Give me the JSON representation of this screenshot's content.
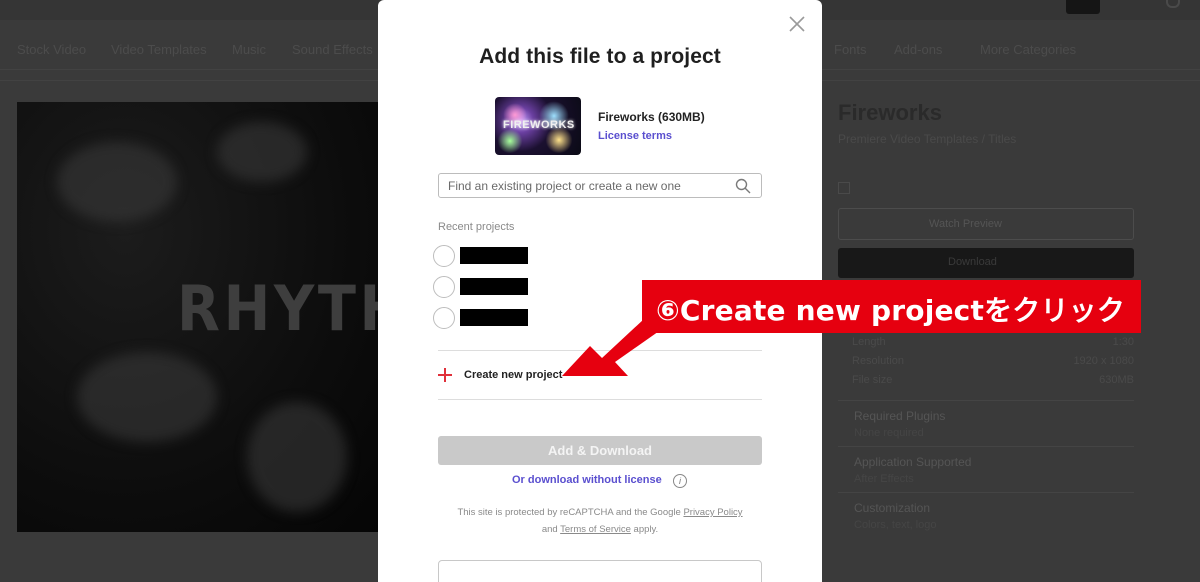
{
  "background": {
    "nav_items": [
      "Stock Video",
      "Video Templates",
      "Music",
      "Sound Effects",
      "Fonts",
      "Add-ons",
      "More Categories"
    ],
    "preview_watermark": "RHYTHM",
    "side": {
      "title": "Fireworks",
      "subtitle": "Premiere Video Templates / Titles",
      "preview_button": "Watch Preview",
      "download_button": "Download",
      "meta": [
        {
          "label": "Length",
          "value": "1:30"
        },
        {
          "label": "Resolution",
          "value": "1920 x 1080"
        },
        {
          "label": "File size",
          "value": "630MB"
        }
      ],
      "sections": [
        {
          "heading": "Required Plugins",
          "sub": "None required"
        },
        {
          "heading": "Application Supported",
          "sub": "After Effects"
        },
        {
          "heading": "Customization",
          "sub": "Colors, text, logo"
        }
      ]
    }
  },
  "modal": {
    "title": "Add this file to a project",
    "file": {
      "thumb_label": "FIREWORKS",
      "name": "Fireworks (630MB)",
      "license_link": "License terms"
    },
    "search": {
      "placeholder": "Find an existing project or create a new one",
      "value": ""
    },
    "recent_label": "Recent projects",
    "recent_projects": [
      "",
      "",
      ""
    ],
    "create_new_label": "Create new project",
    "add_download_label": "Add & Download",
    "no_license_link": "Or download without license",
    "recaptcha": {
      "prefix": "This site is protected by reCAPTCHA and the Google",
      "privacy": "Privacy Policy",
      "and": "and",
      "terms": "Terms of Service",
      "suffix": "apply."
    }
  },
  "annotation": {
    "text": "⑥Create new projectをクリック",
    "color": "#e6000f"
  }
}
